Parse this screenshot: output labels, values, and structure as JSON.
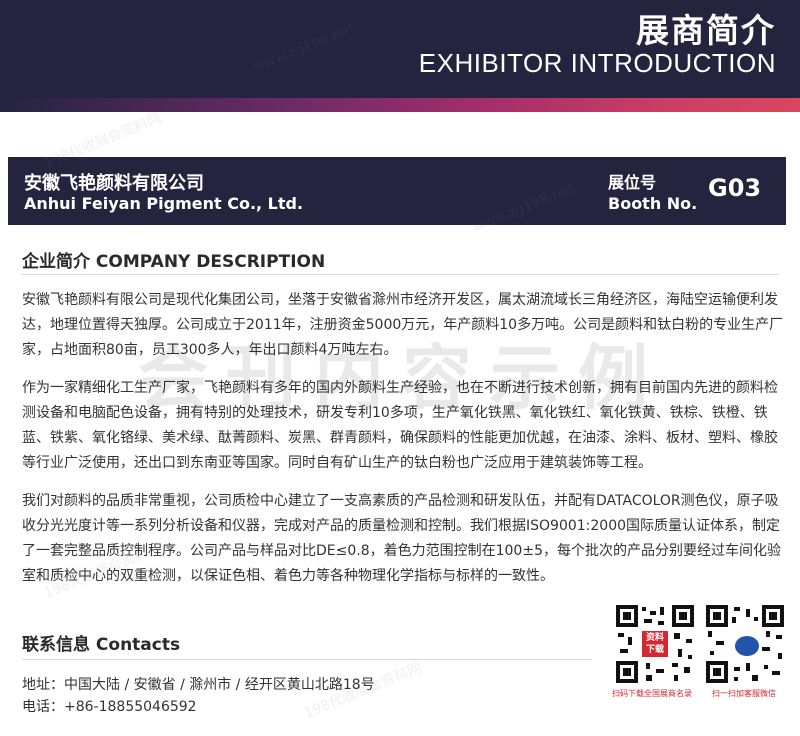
{
  "header": {
    "title_cn": "展商简介",
    "title_en": "EXHIBITOR INTRODUCTION",
    "band_color": "#24243f",
    "accent_color": "#d8465f"
  },
  "company": {
    "name_cn": "安徽飞艳颜料有限公司",
    "name_en": "Anhui Feiyan Pigment Co., Ltd.",
    "booth_label_cn": "展位号",
    "booth_label_en": "Booth No.",
    "booth_number": "G03"
  },
  "description": {
    "heading": "企业简介 COMPANY DESCRIPTION",
    "paragraphs": [
      "安徽飞艳颜料有限公司是现代化集团公司，坐落于安徽省滁州市经济开发区，属太湖流域长三角经济区，海陆空运输便利发达，地理位置得天独厚。公司成立于2011年，注册资金5000万元，年产颜料10多万吨。公司是颜料和钛白粉的专业生产厂家，占地面积80亩，员工300多人，年出口颜料4万吨左右。",
      "作为一家精细化工生产厂家，飞艳颜料有多年的国内外颜料生产经验，也在不断进行技术创新，拥有目前国内先进的颜料检测设备和电脑配色设备，拥有特别的处理技术，研发专利10多项，生产氧化铁黑、氧化铁红、氧化铁黄、铁棕、铁橙、铁蓝、铁紫、氧化铬绿、美术绿、酞菁颜料、炭黑、群青颜料，确保颜料的性能更加优越，在油漆、涂料、板材、塑料、橡胶等行业广泛使用，还出口到东南亚等国家。同时自有矿山生产的钛白粉也广泛应用于建筑装饰等工程。",
      "我们对颜料的品质非常重视，公司质检中心建立了一支高素质的产品检测和研发队伍，并配有DATACOLOR测色仪，原子吸收分光光度计等一系列分析设备和仪器，完成对产品的质量检测和控制。我们根据ISO9001:2000国际质量认证体系，制定了一套完整品质控制程序。公司产品与样品对比DE≤0.8，着色力范围控制在100±5，每个批次的产品分别要经过车间化验室和质检中心的双重检测，以保证色相、着色力等各种物理化学指标与标样的一致性。"
    ]
  },
  "contacts": {
    "heading": "联系信息 Contacts",
    "address": "地址：中国大陆 / 安徽省 / 滁州市 / 经开区黄山北路18号",
    "phone": "电话：+86-18855046592"
  },
  "qr": {
    "left_badge": "资料下载",
    "left_caption": "扫码下载全国展商名录",
    "right_caption": "扫一扫加客服微信"
  },
  "watermark": {
    "main": "会刊内容示例",
    "site": "www.zg198.net",
    "site_cn": "198代收展会资料网"
  }
}
